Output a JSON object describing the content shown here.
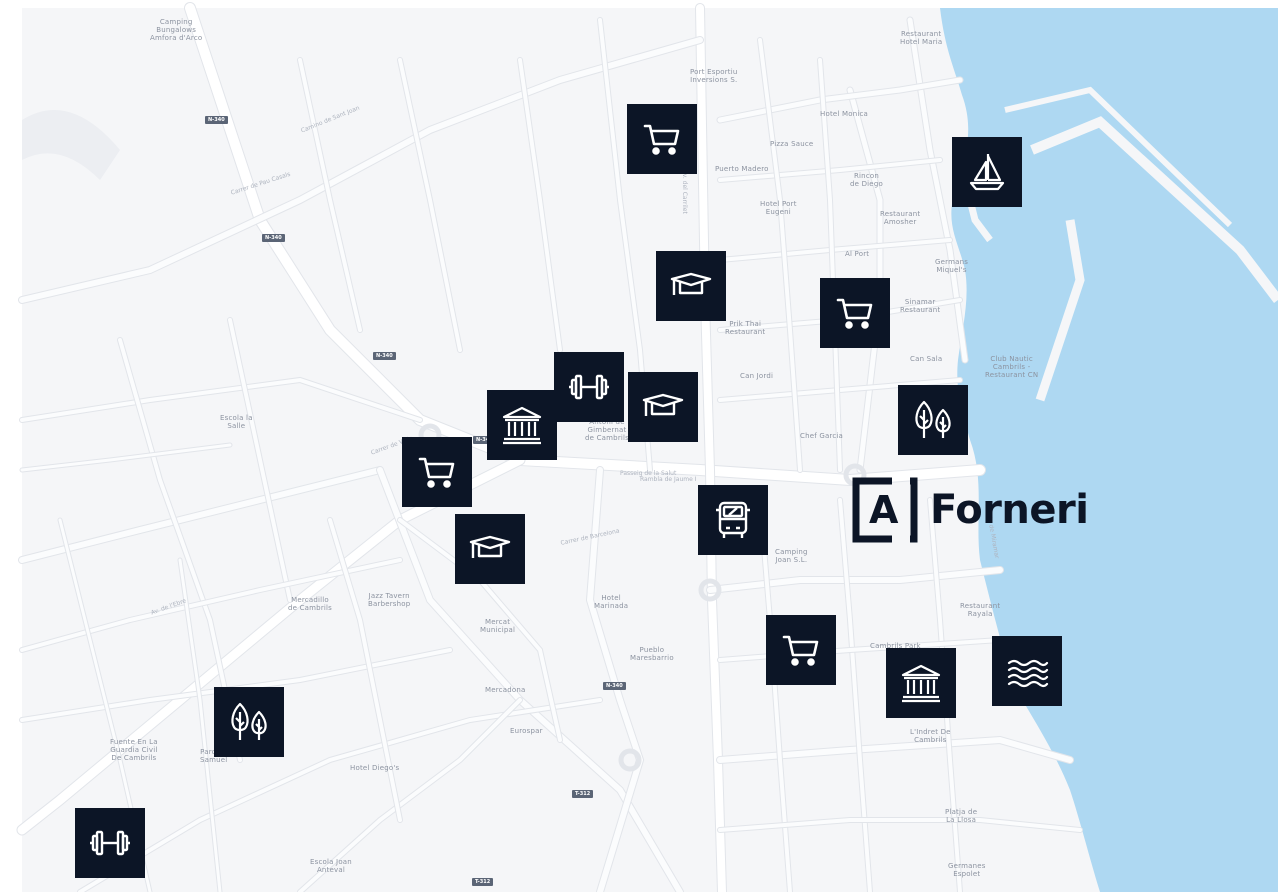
{
  "brand": {
    "mark_letter": "A",
    "name": "Forneri",
    "color": "#0c1526"
  },
  "colors": {
    "sea": "#aed8f2",
    "land": "#f5f6f8",
    "road": "#ffffff",
    "road_outline": "#e3e6eb",
    "label": "#8c93a0",
    "poi_bg": "#0c1526",
    "poi_icon": "#ffffff"
  },
  "pois": [
    {
      "icon": "cart-icon",
      "category": "shopping"
    },
    {
      "icon": "sailboat-icon",
      "category": "port"
    },
    {
      "icon": "graduation-cap-icon",
      "category": "education"
    },
    {
      "icon": "cart-icon",
      "category": "shopping"
    },
    {
      "icon": "dumbbell-icon",
      "category": "gym"
    },
    {
      "icon": "graduation-cap-icon",
      "category": "education"
    },
    {
      "icon": "museum-icon",
      "category": "culture"
    },
    {
      "icon": "trees-icon",
      "category": "park"
    },
    {
      "icon": "cart-icon",
      "category": "shopping"
    },
    {
      "icon": "bus-icon",
      "category": "transport"
    },
    {
      "icon": "graduation-cap-icon",
      "category": "education"
    },
    {
      "icon": "cart-icon",
      "category": "shopping"
    },
    {
      "icon": "museum-icon",
      "category": "culture"
    },
    {
      "icon": "waves-icon",
      "category": "beach"
    },
    {
      "icon": "trees-icon",
      "category": "park"
    },
    {
      "icon": "dumbbell-icon",
      "category": "gym"
    }
  ],
  "place_labels": [
    "Camping\nBungalows\nAmfora d'Arco",
    "Restaurant\nHotel Maria",
    "Port Esportiu\nInversions S.",
    "Hotel Monica",
    "Pizza Sauce",
    "Puerto Madero",
    "Rincon\nde Diego",
    "Hotel Port\nEugeni",
    "Restaurant\nAmosher",
    "Al Port",
    "Germans\nMiquel's",
    "Sinamar\nRestaurant",
    "Prik Thai\nRestaurant",
    "Can Sala",
    "Club Nautic\nCambrils -\nRestaurant CN",
    "Can Jordi",
    "Chef Garcia",
    "Escola la\nSalle",
    "Antoni de\nGimbernat\nde Cambrils",
    "Camping\nJoan S.L.",
    "Mercadillo\nde Cambrils",
    "Jazz Tavern\nBarbershop",
    "Mercat\nMunicipal",
    "Hotel\nMarinada",
    "Pueblo\nMaresbarrio",
    "Restaurant\nRayala",
    "Cambrils Park",
    "Mercadona",
    "Eurospar",
    "Parc de\nSamuel",
    "Hotel Diego's",
    "L'Indret De\nCambrils",
    "Platja de\nLa Llosa",
    "Escola Joan\nAnteval",
    "Germanes\nEspolet",
    "Fuente En La\nGuardia Civil\nDe Cambrils"
  ],
  "road_labels": [
    "Camino de Sant Joan",
    "Carrer de Pau Casals",
    "Passeig de la Salut",
    "Av. del Carrilet",
    "Carrer de Barcelona",
    "Rambla de Jaume I",
    "Av. de l'Ebre",
    "Carrer de Valls",
    "Passeig de Miramar"
  ],
  "highway_shields": [
    "N-340",
    "N-340",
    "N-340",
    "N-340",
    "N-340",
    "T-312",
    "T-312"
  ]
}
